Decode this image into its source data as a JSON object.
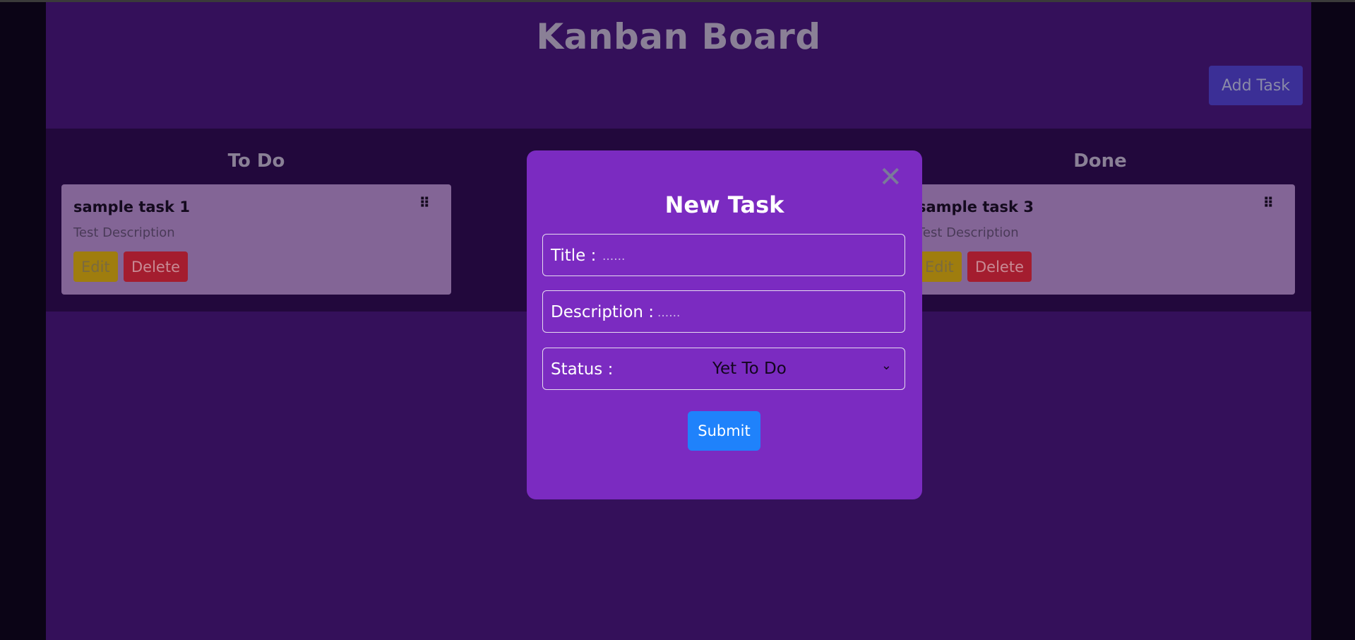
{
  "header": {
    "title": "Kanban Board",
    "add_task_label": "Add Task"
  },
  "columns": [
    {
      "title": "To Do",
      "cards": [
        {
          "title": "sample task 1",
          "description": "Test Description",
          "edit_label": "Edit",
          "delete_label": "Delete",
          "handle_glyph": "⠿"
        }
      ]
    },
    {
      "title": "Done",
      "cards": [
        {
          "title": "sample task 3",
          "description": "Test Description",
          "edit_label": "Edit",
          "delete_label": "Delete",
          "handle_glyph": "⠿"
        }
      ]
    }
  ],
  "modal": {
    "title": "New Task",
    "close_glyph": "✕",
    "title_field": {
      "label": "Title :",
      "value": "",
      "placeholder": "......"
    },
    "description_field": {
      "label": "Description :",
      "value": "",
      "placeholder": "......"
    },
    "status_field": {
      "label": "Status :",
      "selected": "Yet To Do",
      "chevron": "⌄"
    },
    "submit_label": "Submit"
  },
  "colors": {
    "page_bg": "#34105a",
    "board_bg": "#22083c",
    "card_bg": "#836596",
    "modal_bg": "#7b2bc1",
    "submit": "#1f82fb",
    "edit": "#9f7d0e",
    "delete": "#a41d2f",
    "add_task": "#3b2f96"
  },
  "icons": {
    "close": "close-icon",
    "drag": "drag-handle-icon",
    "dropdown": "chevron-down-icon"
  }
}
